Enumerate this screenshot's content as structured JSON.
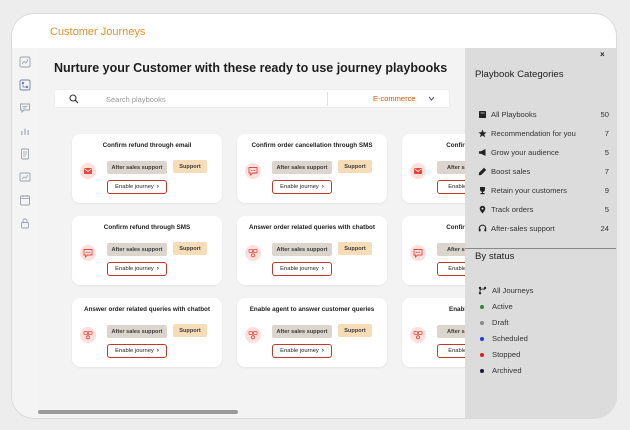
{
  "app": {
    "title": "Customer Journeys"
  },
  "main": {
    "title": "Nurture your Customer with these ready to use  journey playbooks",
    "search": {
      "placeholder": "Search playbooks"
    },
    "filter": {
      "value": "E-commerce"
    }
  },
  "cards": [
    {
      "title": "Confirm refund through email",
      "icon": "email-icon",
      "tag1": "After sales support",
      "tag2": "Support",
      "button": "Enable journey"
    },
    {
      "title": "Confirm order cancellation through SMS",
      "icon": "sms-icon",
      "tag1": "After sales support",
      "tag2": "Support",
      "button": "Enable journey"
    },
    {
      "title": "Confirm order cance",
      "icon": "email-icon",
      "tag1": "After sales sup",
      "tag2": "",
      "button": "Enable journ"
    },
    {
      "title": "Confirm refund through SMS",
      "icon": "sms-icon",
      "tag1": "After sales support",
      "tag2": "Support",
      "button": "Enable journey"
    },
    {
      "title": "Answer order related queries with chatbot",
      "icon": "chatbot-icon",
      "tag1": "After sales support",
      "tag2": "Support",
      "button": "Enable journey"
    },
    {
      "title": "Confirm order cance",
      "icon": "sms-icon",
      "tag1": "After sales sup",
      "tag2": "",
      "button": "Enable journ"
    },
    {
      "title": "Answer order related queries with chatbot",
      "icon": "chatbot-icon",
      "tag1": "After sales support",
      "tag2": "Support",
      "button": "Enable journey"
    },
    {
      "title": "Enable agent to answer customer queries",
      "icon": "chatbot-icon",
      "tag1": "After sales support",
      "tag2": "Support",
      "button": "Enable journey"
    },
    {
      "title": "Enable agent to an",
      "icon": "chatbot-icon",
      "tag1": "After sales sup",
      "tag2": "",
      "button": "Enable journ"
    }
  ],
  "playbook_categories": {
    "title": "Playbook Categories",
    "items": [
      {
        "label": "All Playbooks",
        "count": "50",
        "icon": "book-icon"
      },
      {
        "label": "Recommendation for you",
        "count": "7",
        "icon": "star-icon"
      },
      {
        "label": "Grow your audience",
        "count": "5",
        "icon": "megaphone-icon"
      },
      {
        "label": "Boost sales",
        "count": "7",
        "icon": "pen-icon"
      },
      {
        "label": "Retain your customers",
        "count": "9",
        "icon": "trophy-icon"
      },
      {
        "label": "Track orders",
        "count": "5",
        "icon": "pin-icon"
      },
      {
        "label": "After-sales support",
        "count": "24",
        "icon": "headset-icon"
      }
    ]
  },
  "by_status": {
    "title": "By status",
    "items": [
      {
        "label": "All Journeys",
        "color": "#333333"
      },
      {
        "label": "Active",
        "color": "#2e8b2e"
      },
      {
        "label": "Draft",
        "color": "#8a8a8a"
      },
      {
        "label": "Scheduled",
        "color": "#1f3fd6"
      },
      {
        "label": "Stopped",
        "color": "#d62020"
      },
      {
        "label": "Archived",
        "color": "#1a1a3a"
      }
    ]
  },
  "colors": {
    "accent": "#e5912a",
    "filter": "#d35400",
    "button_border": "#c0392b"
  }
}
